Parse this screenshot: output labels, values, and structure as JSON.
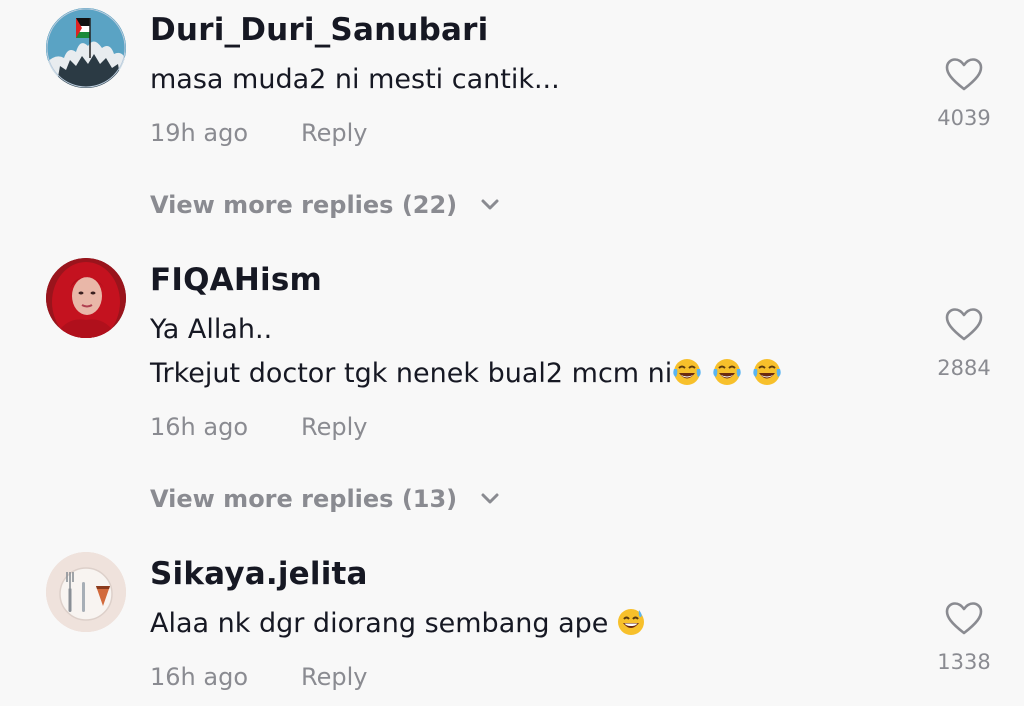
{
  "comments": [
    {
      "username": "Duri_Duri_Sanubari",
      "lines": [
        "masa muda2 ni mesti cantik..."
      ],
      "time": "19h ago",
      "reply_label": "Reply",
      "likes": "4039",
      "view_replies": "View more replies (22)",
      "avatar_icon": "protest-crowd-avatar"
    },
    {
      "username": "FIQAHism",
      "lines": [
        "Ya Allah..",
        "Trkejut doctor tgk nenek bual2 mcm ni"
      ],
      "emoji_after_last_line": [
        "face-with-tears-of-joy",
        "face-with-tears-of-joy",
        "face-with-tears-of-joy"
      ],
      "time": "16h ago",
      "reply_label": "Reply",
      "likes": "2884",
      "view_replies": "View more replies (13)",
      "avatar_icon": "woman-red-hijab-avatar"
    },
    {
      "username": "Sikaya.jelita",
      "lines": [
        "Alaa nk dgr diorang sembang ape"
      ],
      "emoji_after_last_line": [
        "grinning-face-with-sweat"
      ],
      "time": "16h ago",
      "reply_label": "Reply",
      "likes": "1338",
      "avatar_icon": "cutlery-plate-avatar"
    }
  ],
  "colors": {
    "background": "#f8f8f8",
    "primary_text": "#161823",
    "secondary_text": "#8a8b91"
  }
}
